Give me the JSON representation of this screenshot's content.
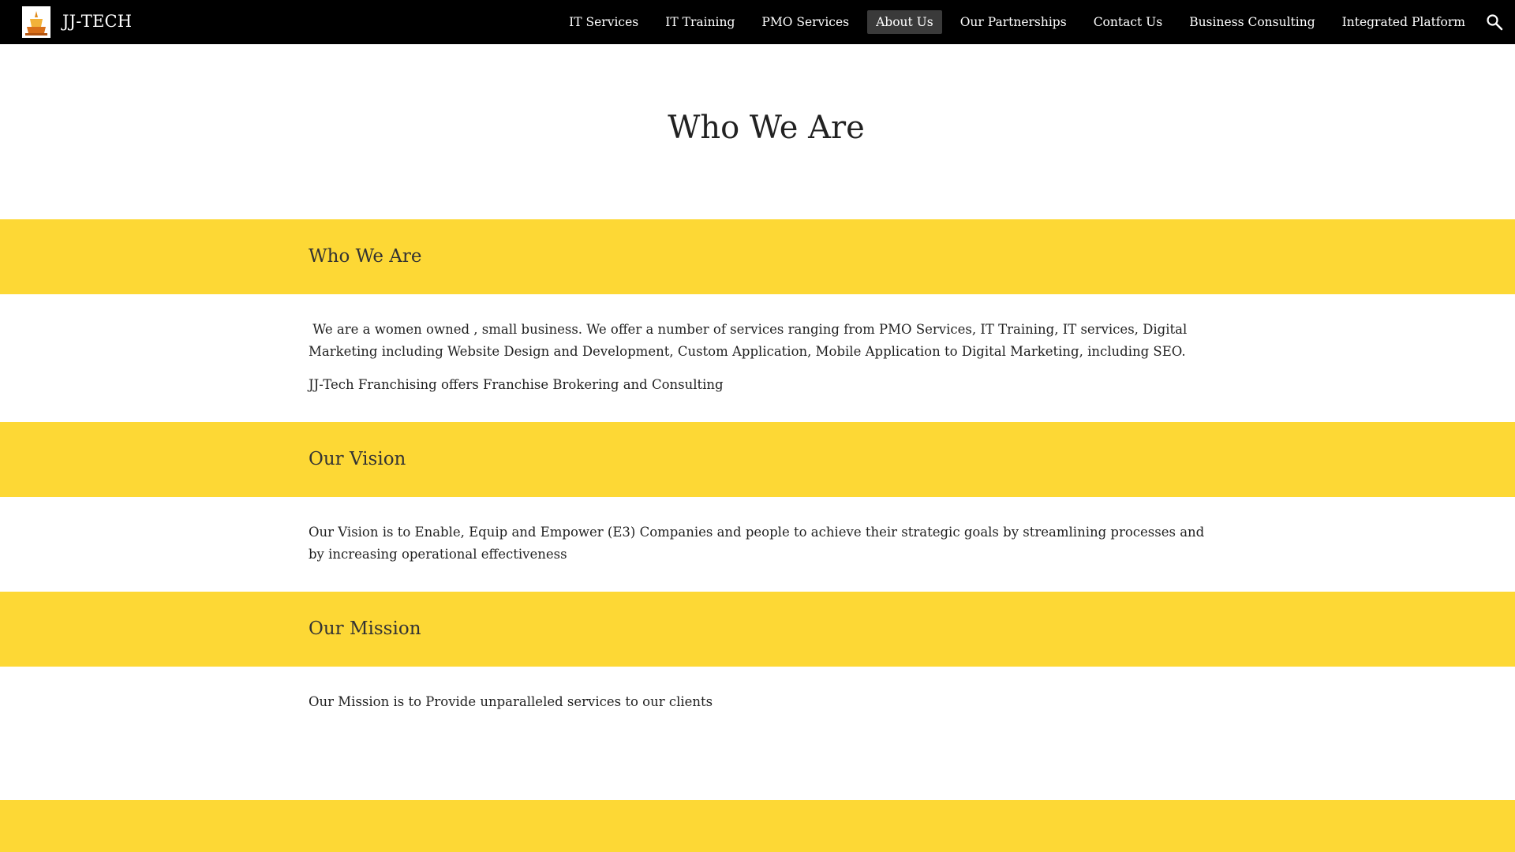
{
  "header": {
    "site_title": "JJ-TECH",
    "nav": [
      {
        "label": "IT Services",
        "active": false
      },
      {
        "label": "IT Training",
        "active": false
      },
      {
        "label": "PMO Services",
        "active": false
      },
      {
        "label": "About Us",
        "active": true
      },
      {
        "label": "Our Partnerships",
        "active": false
      },
      {
        "label": "Contact Us",
        "active": false
      },
      {
        "label": "Business Consulting",
        "active": false
      },
      {
        "label": "Integrated Platform",
        "active": false
      }
    ],
    "search_icon": "search-icon"
  },
  "page_title": "Who We Are",
  "sections": {
    "who": {
      "heading": "Who We Are",
      "paragraph_1": " We are a women owned , small business. We offer a number of services ranging from PMO Services, IT Training, IT services, Digital Marketing including Website Design and Development, Custom Application, Mobile Application to Digital Marketing, including SEO.",
      "paragraph_2": "JJ-Tech Franchising offers Franchise Brokering and Consulting"
    },
    "vision": {
      "heading": "Our Vision",
      "paragraph": "Our Vision is to Enable, Equip and Empower (E3) Companies and people to achieve their strategic goals by streamlining processes and by increasing operational effectiveness"
    },
    "mission": {
      "heading": "Our Mission",
      "paragraph": "Our Mission is to Provide unparalleled services to our clients"
    }
  },
  "colors": {
    "band": "#fdd835",
    "topbar": "#000000",
    "active_nav": "#3a3a3a"
  }
}
